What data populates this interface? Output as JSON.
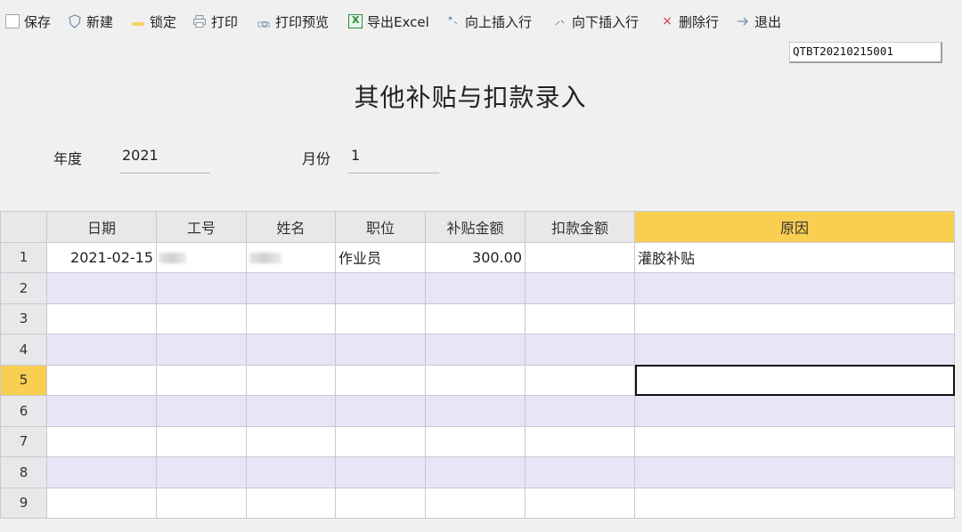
{
  "toolbar": {
    "items": [
      {
        "label": "保存",
        "icon": "save-icon"
      },
      {
        "label": "新建",
        "icon": "new-icon"
      },
      {
        "label": "锁定",
        "icon": "lock-icon"
      },
      {
        "label": "打印",
        "icon": "print-icon"
      },
      {
        "label": "打印预览",
        "icon": "print-preview-icon"
      },
      {
        "label": "导出Excel",
        "icon": "excel-icon"
      },
      {
        "label": "向上插入行",
        "icon": "insert-row-above-icon"
      },
      {
        "label": "向下插入行",
        "icon": "insert-row-below-icon"
      },
      {
        "label": "删除行",
        "icon": "delete-icon"
      },
      {
        "label": "退出",
        "icon": "exit-icon"
      }
    ]
  },
  "header": {
    "form_number": "QTBT20210215001",
    "title": "其他补贴与扣款录入",
    "year_label": "年度",
    "year_value": "2021",
    "month_label": "月份",
    "month_value": "1"
  },
  "grid": {
    "columns": [
      "日期",
      "工号",
      "姓名",
      "职位",
      "补贴金额",
      "扣款金额",
      "原因"
    ],
    "row_numbers": [
      "1",
      "2",
      "3",
      "4",
      "5",
      "6",
      "7",
      "8",
      "9"
    ],
    "rows": [
      {
        "date": "2021-02-15",
        "employee_id": "",
        "name": "",
        "position": "作业员",
        "subsidy": "300.00",
        "deduction": "",
        "reason": "灌胶补贴"
      }
    ],
    "active_row": 5,
    "colors": {
      "header_bg": "#e8e8ea",
      "active_header": "#f9cf52",
      "stripe": "#e7e6f8"
    }
  }
}
